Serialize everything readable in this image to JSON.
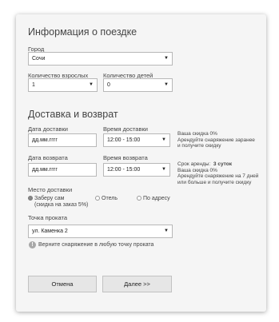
{
  "trip": {
    "title": "Информация о поездке",
    "city_label": "Город",
    "city_value": "Сочи",
    "adults_label": "Количество взрослых",
    "adults_value": "1",
    "children_label": "Количество детей",
    "children_value": "0"
  },
  "delivery": {
    "title": "Доставка и возврат",
    "delivery_date_label": "Дата доставки",
    "delivery_date_value": "дд.мм.гггг",
    "delivery_time_label": "Время доставки",
    "delivery_time_value": "12:00 - 15:00",
    "return_date_label": "Дата возврата",
    "return_date_value": "дд.мм.гггг",
    "return_time_label": "Время возврата",
    "return_time_value": "12:00 - 15:00",
    "discount_note": [
      "Ваша скидка 0%",
      "Арендуйте снаряжение заранее",
      "и получите скидку"
    ],
    "term_label": "Срок аренды:",
    "term_value": "3 суток",
    "term_note": [
      "Ваша скидка 0%",
      "Арендуйте снаряжение на 7 дней",
      "или больше и получите скидку"
    ],
    "place_label": "Место доставки",
    "options": {
      "pickup": "Заберу сам",
      "pickup_sub": "(скидка на заказ 5%)",
      "hotel": "Отель",
      "address": "По адресу"
    },
    "point_label": "Точка проката",
    "point_value": "ул. Каменка 2",
    "point_info": "Верните снаряжение в любую точку проката"
  },
  "buttons": {
    "cancel": "Отмена",
    "next": "Далее >>"
  },
  "icons": {
    "caret": "caret-down-icon",
    "info": "info-icon"
  }
}
